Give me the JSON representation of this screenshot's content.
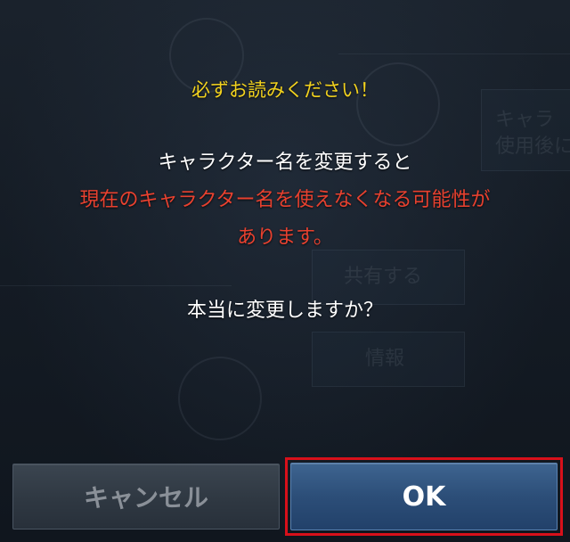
{
  "dialog": {
    "warning_title": "必ずお読みください！",
    "line1": "キャラクター名を変更すると",
    "line2_red": "現在のキャラクター名を使えなくなる可能性が",
    "line3_red": "あります。",
    "confirm_question": "本当に変更しますか？"
  },
  "buttons": {
    "cancel_label": "キャンセル",
    "ok_label": "OK"
  },
  "background": {
    "text_a": "キャラ",
    "text_b": "使用後に",
    "text_c": "共有する",
    "text_d": "情報"
  },
  "colors": {
    "warning": "#f2d21e",
    "alert": "#e8412f",
    "ok_button": "#2c4e78",
    "highlight_frame": "#d8101a"
  }
}
